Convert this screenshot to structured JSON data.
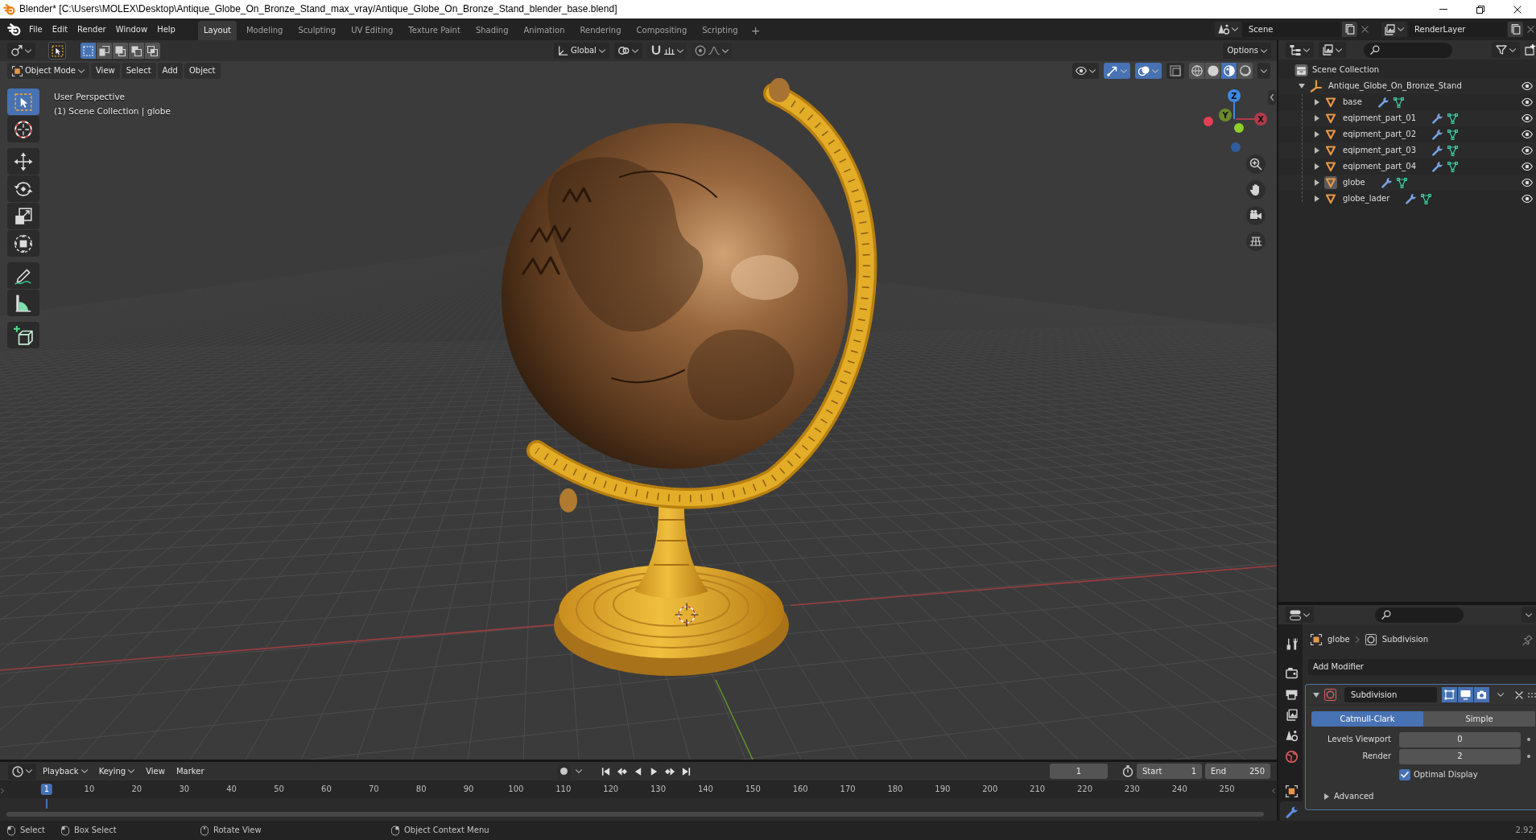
{
  "window": {
    "title": "Blender* [C:\\Users\\MOLEX\\Desktop\\Antique_Globe_On_Bronze_Stand_max_vray/Antique_Globe_On_Bronze_Stand_blender_base.blend]"
  },
  "menu_bar": [
    "File",
    "Edit",
    "Render",
    "Window",
    "Help"
  ],
  "workspace_tabs": [
    {
      "label": "Layout",
      "selected": true
    },
    {
      "label": "Modeling",
      "selected": false
    },
    {
      "label": "Sculpting",
      "selected": false
    },
    {
      "label": "UV Editing",
      "selected": false
    },
    {
      "label": "Texture Paint",
      "selected": false
    },
    {
      "label": "Shading",
      "selected": false
    },
    {
      "label": "Animation",
      "selected": false
    },
    {
      "label": "Rendering",
      "selected": false
    },
    {
      "label": "Compositing",
      "selected": false
    },
    {
      "label": "Scripting",
      "selected": false
    }
  ],
  "add_workspace": "+",
  "scene": "Scene",
  "view_layer": "RenderLayer",
  "viewport": {
    "tool_header": {
      "select_modes": [
        {
          "selected": true
        },
        {
          "selected": false
        },
        {
          "selected": false
        },
        {
          "selected": false
        },
        {
          "selected": false
        }
      ],
      "orientation": "Global",
      "toggles": [
        {
          "kind": "snap",
          "on": false
        },
        {
          "kind": "proportional",
          "on": false
        }
      ],
      "options": "Options"
    },
    "header": {
      "mode": "Object Mode",
      "menus": [
        "View",
        "Select",
        "Add",
        "Object"
      ],
      "toggles": [
        {
          "kind": "gizmo",
          "on": true
        },
        {
          "kind": "overlay",
          "on": true
        },
        {
          "kind": "xray",
          "on": false
        }
      ],
      "shading": [
        {
          "kind": "wireframe",
          "selected": false
        },
        {
          "kind": "solid",
          "selected": false
        },
        {
          "kind": "material",
          "selected": true
        },
        {
          "kind": "rendered",
          "selected": false
        }
      ]
    },
    "toolbar": [
      {
        "tools": [
          {
            "kind": "select_box",
            "selected": true
          },
          {
            "kind": "cursor",
            "selected": false
          }
        ]
      },
      {
        "tools": [
          {
            "kind": "move",
            "selected": false
          },
          {
            "kind": "rotate",
            "selected": false
          },
          {
            "kind": "scale",
            "selected": false
          },
          {
            "kind": "transform",
            "selected": false
          }
        ]
      },
      {
        "tools": [
          {
            "kind": "annotate",
            "selected": false
          },
          {
            "kind": "measure",
            "selected": false
          }
        ]
      },
      {
        "tools": [
          {
            "kind": "add_cube",
            "selected": false
          }
        ]
      }
    ],
    "info": [
      "User Perspective",
      "(1) Scene Collection | globe"
    ],
    "gizmo": [
      {
        "label": "X"
      },
      {
        "label": "Y"
      },
      {
        "label": "Z"
      }
    ]
  },
  "outliner": {
    "root": "Scene Collection",
    "items": [
      {
        "name": "Antique_Globe_On_Bronze_Stand",
        "kind": "empty",
        "expanded": true,
        "visible": true,
        "active": false,
        "children": [
          {
            "name": "base",
            "kind": "mesh",
            "expanded": false,
            "visible": true,
            "active": false
          },
          {
            "name": "eqipment_part_01",
            "kind": "mesh",
            "expanded": false,
            "visible": true,
            "active": false
          },
          {
            "name": "eqipment_part_02",
            "kind": "mesh",
            "expanded": false,
            "visible": true,
            "active": false
          },
          {
            "name": "eqipment_part_03",
            "kind": "mesh",
            "expanded": false,
            "visible": true,
            "active": false
          },
          {
            "name": "eqipment_part_04",
            "kind": "mesh",
            "expanded": false,
            "visible": true,
            "active": false
          },
          {
            "name": "globe",
            "kind": "mesh",
            "expanded": false,
            "visible": true,
            "active": true
          },
          {
            "name": "globe_lader",
            "kind": "mesh",
            "expanded": false,
            "visible": true,
            "active": false
          }
        ]
      }
    ]
  },
  "properties": {
    "tabs": [
      {
        "kind": "tool",
        "selected": false
      },
      {
        "kind": "render",
        "selected": false
      },
      {
        "kind": "output",
        "selected": false
      },
      {
        "kind": "view_layer",
        "selected": false
      },
      {
        "kind": "scene",
        "selected": false
      },
      {
        "kind": "world",
        "selected": false
      },
      {
        "kind": "object",
        "selected": false
      },
      {
        "kind": "modifiers",
        "selected": true
      }
    ],
    "breadcrumb": [
      "globe",
      "Subdivision"
    ],
    "add_modifier": "Add Modifier",
    "modifier": {
      "name": "Subdivision",
      "expanded": true,
      "editmode": true,
      "viewport": true,
      "render": true,
      "types": [
        {
          "label": "Catmull-Clark",
          "selected": true
        },
        {
          "label": "Simple",
          "selected": false
        }
      ],
      "fields": [
        {
          "label": "Levels Viewport",
          "value": "0"
        },
        {
          "label": "Render",
          "value": "2"
        }
      ],
      "options": [
        {
          "label": "Optimal Display",
          "checked": true
        }
      ],
      "sections": [
        {
          "label": "Advanced",
          "expanded": false
        }
      ]
    }
  },
  "timeline": {
    "menus": [
      "Playback",
      "Keying",
      "View",
      "Marker"
    ],
    "auto_keying": false,
    "current_frame": "1",
    "start": {
      "label": "Start",
      "value": "1"
    },
    "end": {
      "label": "End",
      "value": "250"
    },
    "ruler": [
      {
        "label": "1",
        "selected": true
      },
      {
        "label": "10",
        "selected": false
      },
      {
        "label": "20",
        "selected": false
      },
      {
        "label": "30",
        "selected": false
      },
      {
        "label": "40",
        "selected": false
      },
      {
        "label": "50",
        "selected": false
      },
      {
        "label": "60",
        "selected": false
      },
      {
        "label": "70",
        "selected": false
      },
      {
        "label": "80",
        "selected": false
      },
      {
        "label": "90",
        "selected": false
      },
      {
        "label": "100",
        "selected": false
      },
      {
        "label": "110",
        "selected": false
      },
      {
        "label": "120",
        "selected": false
      },
      {
        "label": "130",
        "selected": false
      },
      {
        "label": "140",
        "selected": false
      },
      {
        "label": "150",
        "selected": false
      },
      {
        "label": "160",
        "selected": false
      },
      {
        "label": "170",
        "selected": false
      },
      {
        "label": "180",
        "selected": false
      },
      {
        "label": "190",
        "selected": false
      },
      {
        "label": "200",
        "selected": false
      },
      {
        "label": "210",
        "selected": false
      },
      {
        "label": "220",
        "selected": false
      },
      {
        "label": "230",
        "selected": false
      },
      {
        "label": "240",
        "selected": false
      },
      {
        "label": "250",
        "selected": false
      }
    ]
  },
  "status_bar": {
    "hints": [
      {
        "kind": "left",
        "label": "Select"
      },
      {
        "kind": "left_drag",
        "label": "Box Select"
      },
      {
        "kind": "middle",
        "label": "Rotate View"
      },
      {
        "kind": "right",
        "label": "Object Context Menu"
      }
    ],
    "version": "2.92."
  }
}
